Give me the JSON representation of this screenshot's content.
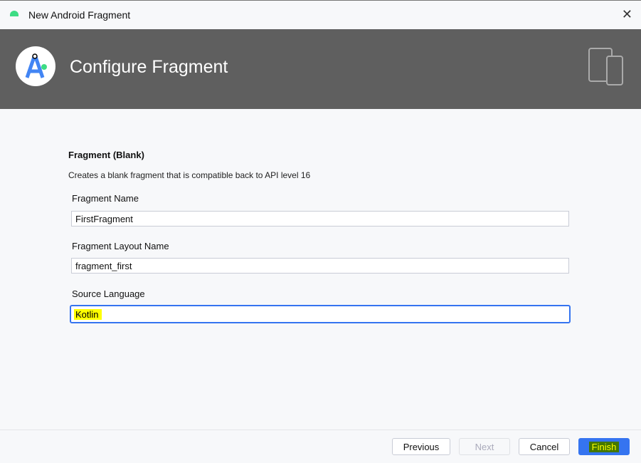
{
  "window": {
    "title": "New Android Fragment",
    "close": "✕"
  },
  "header": {
    "title": "Configure Fragment"
  },
  "template": {
    "name": "Fragment (Blank)",
    "description": "Creates a blank fragment that is compatible back to API level 16"
  },
  "fields": {
    "fragment_name": {
      "label": "Fragment Name",
      "value": "FirstFragment"
    },
    "layout_name": {
      "label": "Fragment Layout Name",
      "value": "fragment_first"
    },
    "source_language": {
      "label": "Source Language",
      "value": "Kotlin"
    }
  },
  "buttons": {
    "previous": "Previous",
    "next": "Next",
    "cancel": "Cancel",
    "finish": "Finish"
  }
}
